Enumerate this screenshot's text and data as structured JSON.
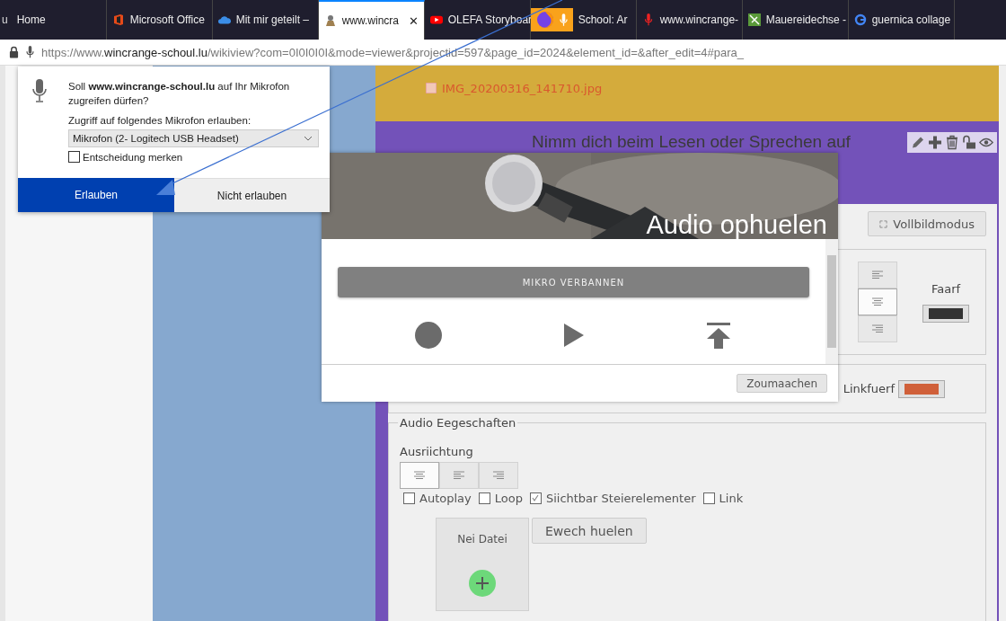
{
  "browser": {
    "cut_tab_text": "u",
    "tabs": [
      {
        "title": "Home",
        "kind": "plain",
        "selected": false
      },
      {
        "title": "Microsoft Office",
        "kind": "office",
        "selected": false
      },
      {
        "title": "Mit mir geteilt –",
        "kind": "cloud",
        "selected": false
      },
      {
        "title": "www.wincra",
        "kind": "site",
        "selected": true,
        "close": "✕"
      },
      {
        "title": "OLEFA Storyboar",
        "kind": "video",
        "selected": false
      },
      {
        "title": "School: Ar",
        "kind": "sharing",
        "selected": false
      },
      {
        "title": "www.wincrange-",
        "kind": "mic",
        "selected": false
      },
      {
        "title": "Mauereidechse -",
        "kind": "lizard",
        "selected": false
      },
      {
        "title": "guernica collage",
        "kind": "g",
        "selected": false
      }
    ],
    "url": {
      "scheme": "https://www.",
      "domain": "wincrange-schoul.lu",
      "path": "/wikiview?com=0I0I0I0I&mode=viewer&projectid=597&page_id=2024&element_id=&after_edit=4#para_"
    }
  },
  "permission_popup": {
    "question_prefix": "Soll ",
    "question_site": "www.wincrange-schoul.lu",
    "question_suffix": " auf Ihr Mikrofon zugreifen dürfen?",
    "device_label": "Zugriff auf folgendes Mikrofon erlauben:",
    "device": "Mikrofon (2- Logitech USB Headset)",
    "remember": {
      "label": "Entscheidung merken",
      "checked": false
    },
    "allow": "Erlauben",
    "deny": "Nicht erlauben"
  },
  "page": {
    "file_link": "IMG_20200316_141710.jpg",
    "section_title": "Nimm dich beim Lesen oder Sprechen auf",
    "fullscreen_button": "Vollbildmodus",
    "align_stack": [
      {
        "kind": "left",
        "selected": false
      },
      {
        "kind": "center",
        "selected": true
      },
      {
        "kind": "right",
        "selected": false
      }
    ],
    "color_label": "Faarf",
    "link_color_label": "Linkfuerf",
    "audio_properties": {
      "legend": "Audio Eegeschaften",
      "alignment_label": "Ausriichtung",
      "alignment": [
        {
          "kind": "center",
          "selected": true
        },
        {
          "kind": "left",
          "selected": false
        },
        {
          "kind": "right",
          "selected": false
        }
      ],
      "options": [
        {
          "label": "Autoplay",
          "checked": false
        },
        {
          "label": "Loop",
          "checked": false
        },
        {
          "label": "Siichtbar Steierelementer",
          "checked": true
        },
        {
          "label": "Link",
          "checked": false
        }
      ],
      "new_file": "Nei Datei",
      "remove_button": "Ewech huelen"
    }
  },
  "modal": {
    "title": "Audio ophuelen",
    "connect_button": "MIKRO VERBANNEN",
    "close_button": "Zoumaachen"
  }
}
